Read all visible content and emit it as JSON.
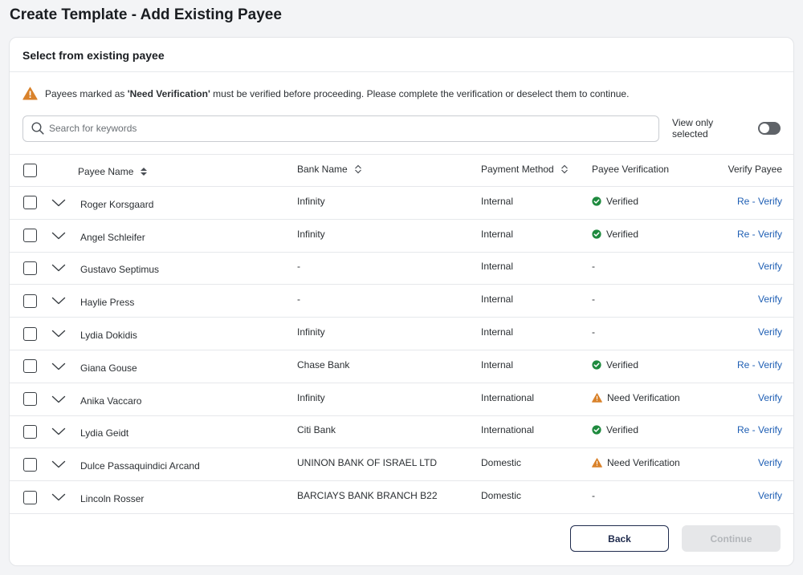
{
  "page": {
    "title": "Create Template - Add Existing Payee"
  },
  "card": {
    "title": "Select from existing payee"
  },
  "warning": {
    "prefix": "Payees marked as ",
    "highlight": "'Need Verification'",
    "suffix": " must be verified before proceeding. Please complete the verification or deselect them to continue."
  },
  "search": {
    "placeholder": "Search for keywords",
    "value": ""
  },
  "view_only": {
    "label": "View only selected",
    "enabled": false
  },
  "table": {
    "headers": {
      "payee_name": "Payee Name",
      "bank_name": "Bank Name",
      "payment_method": "Payment Method",
      "payee_verification": "Payee Verification",
      "verify_payee": "Verify Payee"
    },
    "rows": [
      {
        "name": "Roger Korsgaard",
        "bank": "Infinity",
        "method": "Internal",
        "verification": "Verified",
        "status": "verified",
        "action": "Re - Verify"
      },
      {
        "name": "Angel Schleifer",
        "bank": "Infinity",
        "method": "Internal",
        "verification": "Verified",
        "status": "verified",
        "action": "Re - Verify"
      },
      {
        "name": "Gustavo Septimus",
        "bank": "-",
        "method": "Internal",
        "verification": "-",
        "status": "none",
        "action": "Verify"
      },
      {
        "name": "Haylie Press",
        "bank": "-",
        "method": "Internal",
        "verification": "-",
        "status": "none",
        "action": "Verify"
      },
      {
        "name": "Lydia Dokidis",
        "bank": "Infinity",
        "method": "Internal",
        "verification": "-",
        "status": "none",
        "action": "Verify"
      },
      {
        "name": "Giana Gouse",
        "bank": "Chase Bank",
        "method": "Internal",
        "verification": "Verified",
        "status": "verified",
        "action": "Re - Verify"
      },
      {
        "name": "Anika Vaccaro",
        "bank": "Infinity",
        "method": "International",
        "verification": "Need Verification",
        "status": "warning",
        "action": "Verify"
      },
      {
        "name": "Lydia Geidt",
        "bank": "Citi Bank",
        "method": "International",
        "verification": "Verified",
        "status": "verified",
        "action": "Re - Verify"
      },
      {
        "name": "Dulce Passaquindici Arcand",
        "bank": "UNINON BANK OF ISRAEL LTD",
        "method": "Domestic",
        "verification": "Need Verification",
        "status": "warning",
        "action": "Verify"
      },
      {
        "name": "Lincoln Rosser",
        "bank": "BARCIAYS BANK BRANCH B22",
        "method": "Domestic",
        "verification": "-",
        "status": "none",
        "action": "Verify"
      }
    ]
  },
  "footer": {
    "back_label": "Back",
    "continue_label": "Continue"
  },
  "colors": {
    "verified": "#1e8a3e",
    "warning": "#d9822b",
    "link": "#1f5fb4",
    "primary_dark": "#1f2b4d"
  }
}
